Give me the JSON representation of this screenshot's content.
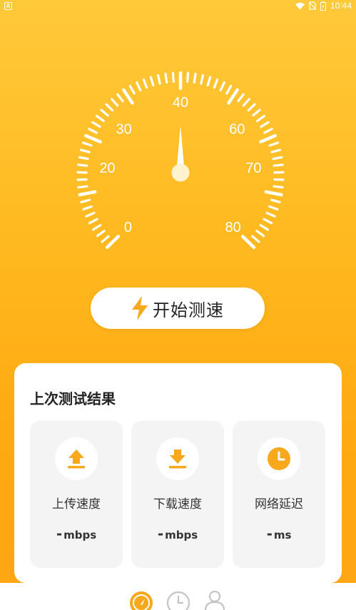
{
  "status_bar": {
    "left_badge": "A",
    "time": "10:44"
  },
  "gauge": {
    "labels": [
      "0",
      "20",
      "30",
      "40",
      "60",
      "70",
      "80"
    ],
    "needle_value": 40
  },
  "start_button": {
    "label": "开始测速",
    "icon": "lightning-bolt-icon"
  },
  "results": {
    "title": "上次测试结果",
    "metrics": [
      {
        "label": "上传速度",
        "value": "-",
        "unit": "mbps",
        "icon": "upload-icon"
      },
      {
        "label": "下载速度",
        "value": "-",
        "unit": "mbps",
        "icon": "download-icon"
      },
      {
        "label": "网络延迟",
        "value": "-",
        "unit": "ms",
        "icon": "clock-icon"
      }
    ]
  },
  "bottom_nav": {
    "items": [
      {
        "icon": "speedometer-icon",
        "active": true
      },
      {
        "icon": "history-clock-icon",
        "active": false
      },
      {
        "icon": "profile-icon",
        "active": false
      }
    ]
  },
  "colors": {
    "accent": "#FFB41F",
    "icon_orange": "#F7A81B",
    "white": "#FFFFFF"
  }
}
